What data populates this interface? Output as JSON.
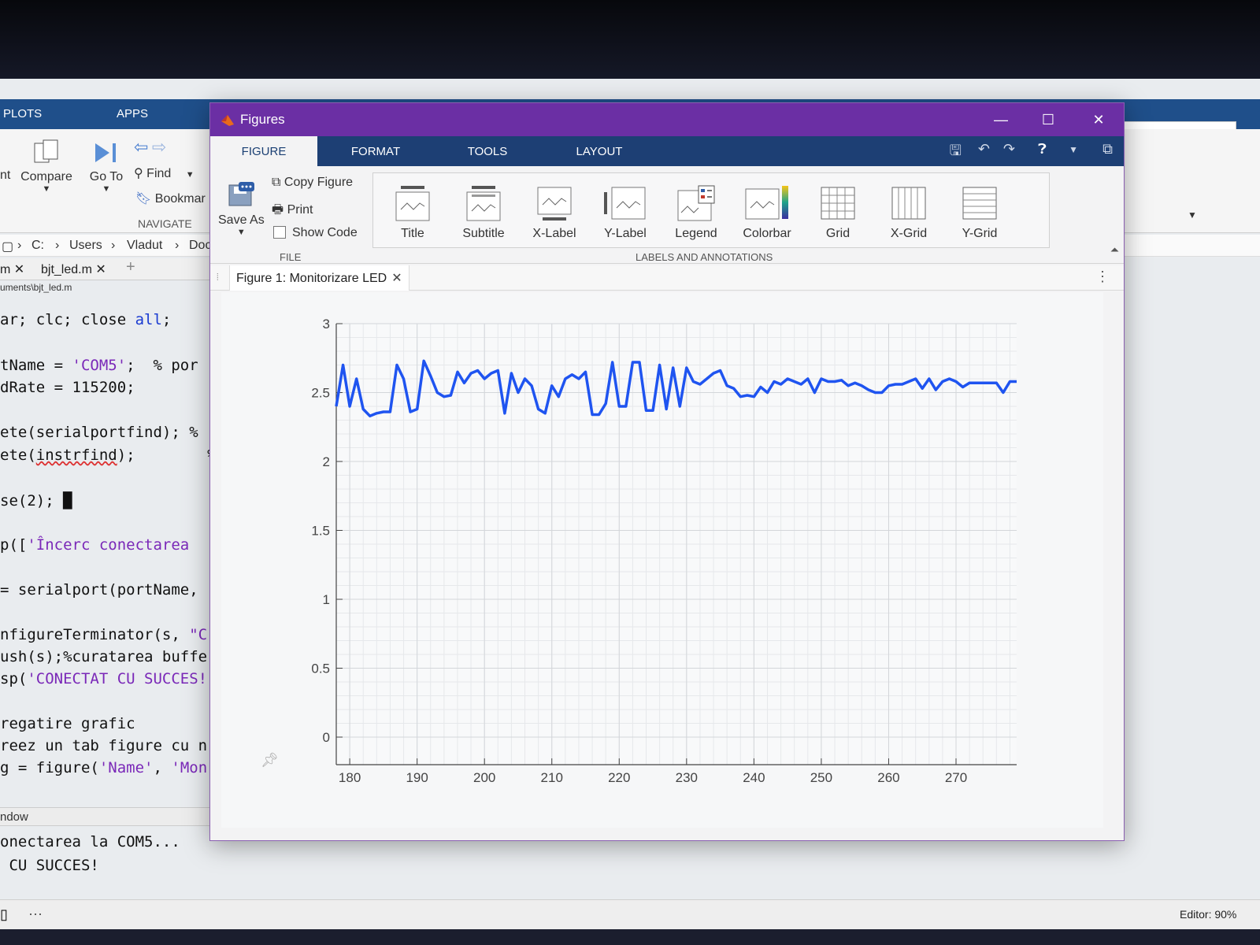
{
  "desktop": {
    "tabs": [
      "PLOTS",
      "APPS"
    ],
    "ribbon": {
      "compare": "Compare",
      "goto": "Go To",
      "find": "Find",
      "bookmark": "Bookmar",
      "navigate": "NAVIGATE",
      "cut_label": "nt"
    },
    "path": [
      "C:",
      "Users",
      "Vladut",
      "Doc"
    ],
    "editor_tabs": [
      "m",
      "bjt_led.m"
    ],
    "editor_path": "uments\\bjt_led.m",
    "code_lines": [
      {
        "segments": [
          {
            "t": "ar; clc; close ",
            "c": ""
          },
          {
            "t": "all",
            "c": "kw"
          },
          {
            "t": ";",
            "c": ""
          }
        ]
      },
      {
        "segments": [
          {
            "t": "tName = ",
            "c": ""
          },
          {
            "t": "'COM5'",
            "c": "str"
          },
          {
            "t": ";  % por",
            "c": ""
          }
        ]
      },
      {
        "segments": [
          {
            "t": "dRate = 115200;",
            "c": ""
          }
        ]
      },
      {
        "segments": [
          {
            "t": "ete(serialportfind); %",
            "c": ""
          }
        ]
      },
      {
        "segments": [
          {
            "t": "ete(",
            "c": ""
          },
          {
            "t": "instrfind",
            "c": "squig"
          },
          {
            "t": ");        %",
            "c": ""
          }
        ]
      },
      {
        "segments": [
          {
            "t": "se(2); ",
            "c": ""
          },
          {
            "t": "█",
            "c": ""
          }
        ]
      },
      {
        "segments": [
          {
            "t": "p([",
            "c": ""
          },
          {
            "t": "'Încerc conectarea",
            "c": "str"
          }
        ]
      },
      {
        "segments": [
          {
            "t": "= serialport(portName,",
            "c": ""
          }
        ]
      },
      {
        "segments": [
          {
            "t": "nfigureTerminator(s, ",
            "c": ""
          },
          {
            "t": "\"C",
            "c": "str"
          }
        ]
      },
      {
        "segments": [
          {
            "t": "ush(s);%curatarea buffe",
            "c": ""
          }
        ]
      },
      {
        "segments": [
          {
            "t": "sp(",
            "c": ""
          },
          {
            "t": "'CONECTAT CU SUCCES!",
            "c": "str"
          }
        ]
      },
      {
        "segments": [
          {
            "t": "regatire grafic",
            "c": ""
          }
        ]
      },
      {
        "segments": [
          {
            "t": "reez un tab figure cu n",
            "c": ""
          }
        ]
      },
      {
        "segments": [
          {
            "t": "g = figure(",
            "c": ""
          },
          {
            "t": "'Name'",
            "c": "str"
          },
          {
            "t": ", ",
            "c": ""
          },
          {
            "t": "'Mon",
            "c": "str"
          }
        ]
      }
    ],
    "cmd_window_label": "ndow",
    "cmd_output": [
      "onectarea la COM5...",
      " CU SUCCES!"
    ],
    "status_editor": "Editor: 90%"
  },
  "figures": {
    "title": "Figures",
    "tabs": [
      "FIGURE",
      "FORMAT",
      "TOOLS",
      "LAYOUT"
    ],
    "selected_tab": "FIGURE",
    "file_group": {
      "save_as": "Save As",
      "copy_figure": "Copy Figure",
      "print": "Print",
      "show_code": "Show Code",
      "label": "FILE"
    },
    "annotations": {
      "label": "LABELS AND ANNOTATIONS",
      "buttons": [
        "Title",
        "Subtitle",
        "X-Label",
        "Y-Label",
        "Legend",
        "Colorbar",
        "Grid",
        "X-Grid",
        "Y-Grid"
      ]
    },
    "document_tab": "Figure 1: Monitorizare LED",
    "colors": {
      "title_bar": "#6b2fa4",
      "tab_bar": "#1d3f74",
      "line": "#1f54f0"
    }
  },
  "chart_data": {
    "type": "line",
    "title": "",
    "xlabel": "",
    "ylabel": "",
    "xlim": [
      178,
      279
    ],
    "ylim": [
      -0.2,
      3
    ],
    "xticks": [
      180,
      190,
      200,
      210,
      220,
      230,
      240,
      250,
      260,
      270
    ],
    "yticks": [
      0,
      0.5,
      1,
      1.5,
      2,
      2.5,
      3
    ],
    "ytick_labels": [
      "0",
      "0.5",
      "1",
      "1.5",
      "2",
      "2.5",
      "3"
    ],
    "grid": true,
    "minor_grid": true,
    "series": [
      {
        "color": "#1f54f0",
        "x": [
          178,
          179,
          180,
          181,
          182,
          183,
          184,
          185,
          186,
          187,
          188,
          189,
          190,
          191,
          192,
          193,
          194,
          195,
          196,
          197,
          198,
          199,
          200,
          201,
          202,
          203,
          204,
          205,
          206,
          207,
          208,
          209,
          210,
          211,
          212,
          213,
          214,
          215,
          216,
          217,
          218,
          219,
          220,
          221,
          222,
          223,
          224,
          225,
          226,
          227,
          228,
          229,
          230,
          231,
          232,
          233,
          234,
          235,
          236,
          237,
          238,
          239,
          240,
          241,
          242,
          243,
          244,
          245,
          246,
          247,
          248,
          249,
          250,
          251,
          252,
          253,
          254,
          255,
          256,
          257,
          258,
          259,
          260,
          261,
          262,
          263,
          264,
          265,
          266,
          267,
          268,
          269,
          270,
          271,
          272,
          273,
          274,
          275,
          276,
          277,
          278,
          279
        ],
        "y": [
          2.4,
          2.7,
          2.4,
          2.6,
          2.38,
          2.33,
          2.35,
          2.36,
          2.36,
          2.7,
          2.6,
          2.36,
          2.38,
          2.73,
          2.62,
          2.5,
          2.47,
          2.48,
          2.65,
          2.57,
          2.64,
          2.66,
          2.6,
          2.64,
          2.66,
          2.35,
          2.64,
          2.5,
          2.6,
          2.55,
          2.38,
          2.35,
          2.55,
          2.47,
          2.6,
          2.63,
          2.6,
          2.65,
          2.34,
          2.34,
          2.42,
          2.72,
          2.4,
          2.4,
          2.72,
          2.72,
          2.37,
          2.37,
          2.7,
          2.38,
          2.68,
          2.4,
          2.68,
          2.58,
          2.56,
          2.6,
          2.64,
          2.66,
          2.55,
          2.53,
          2.47,
          2.48,
          2.47,
          2.54,
          2.5,
          2.58,
          2.56,
          2.6,
          2.58,
          2.56,
          2.6,
          2.5,
          2.6,
          2.58,
          2.58,
          2.59,
          2.55,
          2.57,
          2.55,
          2.52,
          2.5,
          2.5,
          2.55,
          2.56,
          2.56,
          2.58,
          2.6,
          2.53,
          2.6,
          2.52,
          2.58,
          2.6,
          2.58,
          2.54,
          2.57,
          2.57,
          2.57,
          2.57,
          2.57,
          2.5,
          2.58,
          2.58
        ]
      }
    ]
  }
}
